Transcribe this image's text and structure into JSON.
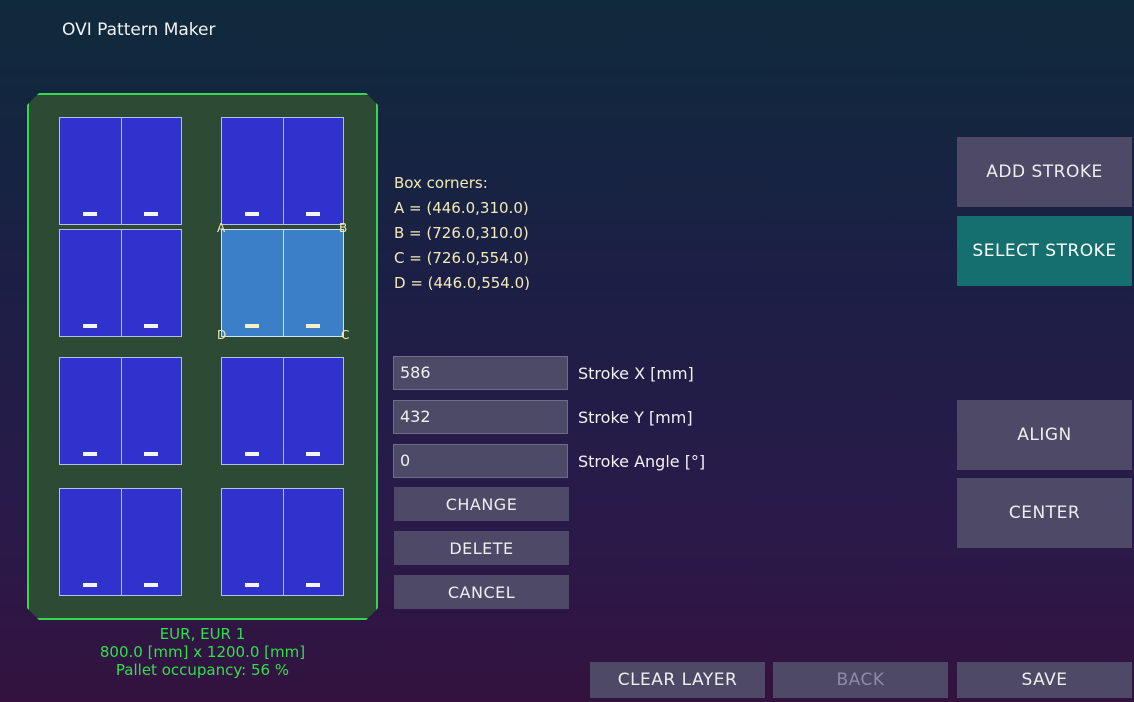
{
  "app": {
    "title": "OVI Pattern Maker"
  },
  "corners": {
    "title": "Box corners:",
    "a": "A = (446.0,310.0)",
    "b": "B = (726.0,310.0)",
    "c": "C = (726.0,554.0)",
    "d": "D = (446.0,554.0)",
    "labels": {
      "a": "A",
      "b": "B",
      "c": "C",
      "d": "D"
    }
  },
  "fields": {
    "stroke_x": {
      "value": "586",
      "label": "Stroke X [mm]"
    },
    "stroke_y": {
      "value": "432",
      "label": "Stroke Y [mm]"
    },
    "stroke_angle": {
      "value": "0",
      "label": "Stroke Angle [°]"
    }
  },
  "actions": {
    "change": "CHANGE",
    "delete": "DELETE",
    "cancel": "CANCEL"
  },
  "side": {
    "add_stroke": "ADD STROKE",
    "select_stroke": "SELECT STROKE",
    "align": "ALIGN",
    "center": "CENTER"
  },
  "bottom": {
    "clear_layer": "CLEAR LAYER",
    "back": "BACK",
    "save": "SAVE"
  },
  "pallet": {
    "type": "EUR, EUR 1",
    "dims": "800.0 [mm] x 1200.0 [mm]",
    "occupancy": "Pallet occupancy: 56 %",
    "selected_box": 3
  },
  "colors": {
    "pallet_border": "#35d84a",
    "box": "#2f32cc",
    "box_selected": "#3b7fc9",
    "button": "#4d4966",
    "button_active": "#146f6e",
    "info_text": "#2fe04a"
  }
}
